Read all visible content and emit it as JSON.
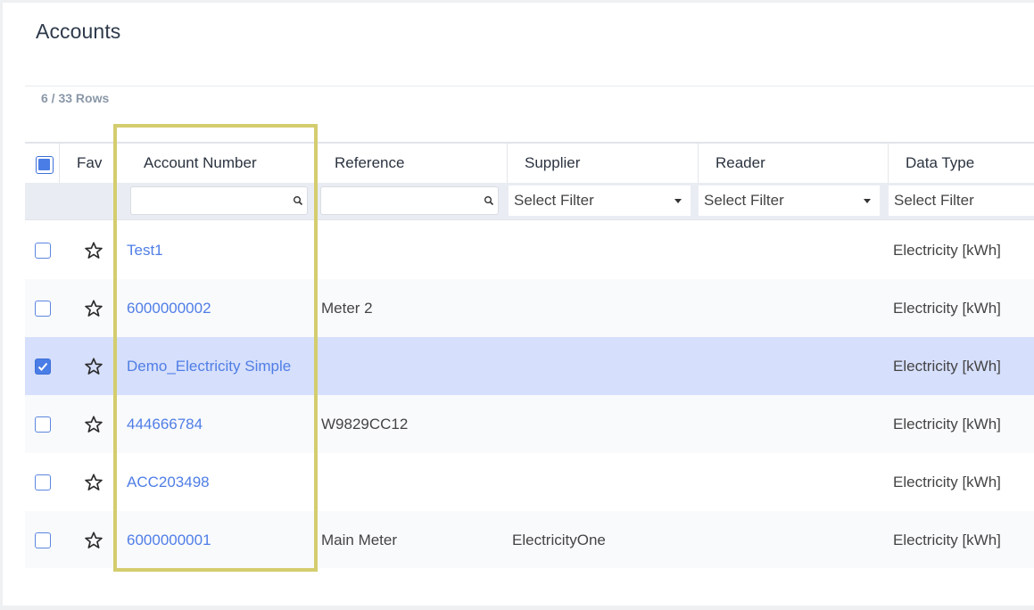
{
  "page": {
    "title": "Accounts",
    "row_count": "6 / 33 Rows"
  },
  "columns": {
    "fav": "Fav",
    "account_number": "Account Number",
    "reference": "Reference",
    "supplier": "Supplier",
    "reader": "Reader",
    "data_type": "Data Type"
  },
  "filters": {
    "account_number": {
      "value": "",
      "placeholder": ""
    },
    "reference": {
      "value": "",
      "placeholder": ""
    },
    "supplier": "Select Filter",
    "reader": "Select Filter",
    "data_type": "Select Filter"
  },
  "rows": [
    {
      "account": "Test1",
      "reference": "",
      "supplier": "",
      "reader": "",
      "data_type": "Electricity [kWh]",
      "checked": false
    },
    {
      "account": "6000000002",
      "reference": "Meter 2",
      "supplier": "",
      "reader": "",
      "data_type": "Electricity [kWh]",
      "checked": false
    },
    {
      "account": "Demo_Electricity Simple",
      "reference": "",
      "supplier": "",
      "reader": "",
      "data_type": "Electricity [kWh]",
      "checked": true
    },
    {
      "account": "444666784",
      "reference": "W9829CC12",
      "supplier": "",
      "reader": "",
      "data_type": "Electricity [kWh]",
      "checked": false
    },
    {
      "account": "ACC203498",
      "reference": "",
      "supplier": "",
      "reader": "",
      "data_type": "Electricity [kWh]",
      "checked": false
    },
    {
      "account": "6000000001",
      "reference": "Main Meter",
      "supplier": "ElectricityOne",
      "reader": "",
      "data_type": "Electricity [kWh]",
      "checked": false
    }
  ],
  "icons": {
    "favorite": "star-icon",
    "search": "search-icon",
    "dropdown": "chevron-down-icon"
  },
  "colors": {
    "link": "#4f7ee6",
    "selected_row": "#d6dffb",
    "highlight_border": "#d4cd6e",
    "checkbox": "#4a7de6"
  }
}
